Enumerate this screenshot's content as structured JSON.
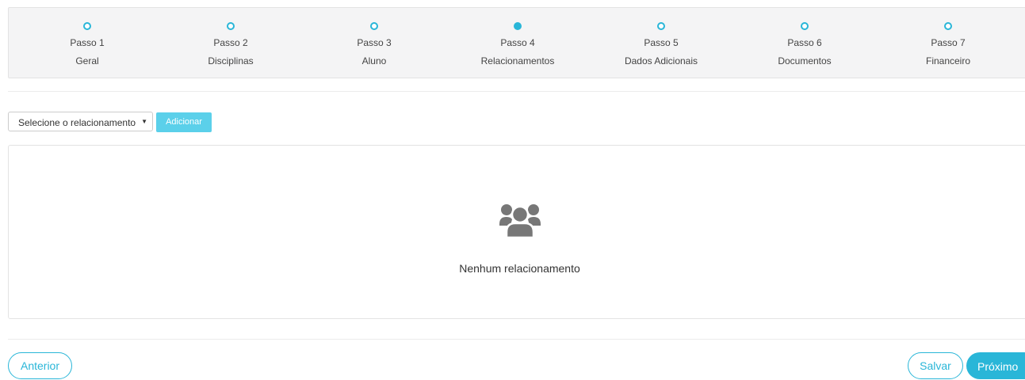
{
  "steps": [
    {
      "num": "Passo 1",
      "name": "Geral",
      "active": false
    },
    {
      "num": "Passo 2",
      "name": "Disciplinas",
      "active": false
    },
    {
      "num": "Passo 3",
      "name": "Aluno",
      "active": false
    },
    {
      "num": "Passo 4",
      "name": "Relacionamentos",
      "active": true
    },
    {
      "num": "Passo 5",
      "name": "Dados Adicionais",
      "active": false
    },
    {
      "num": "Passo 6",
      "name": "Documentos",
      "active": false
    },
    {
      "num": "Passo 7",
      "name": "Financeiro",
      "active": false
    }
  ],
  "relationship": {
    "select_value": "Selecione o relacionamento",
    "add_label": "Adicionar"
  },
  "empty_state": {
    "icon": "users-icon",
    "text": "Nenhum relacionamento"
  },
  "footer": {
    "prev_label": "Anterior",
    "save_label": "Salvar",
    "next_label": "Próximo"
  },
  "colors": {
    "accent": "#29b6d8",
    "add_button": "#5bd0ea",
    "icon": "#777777"
  }
}
